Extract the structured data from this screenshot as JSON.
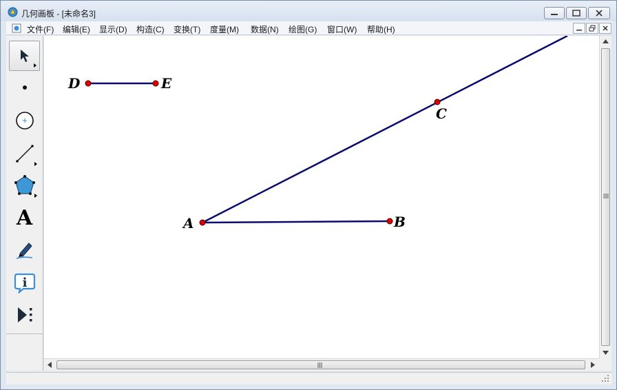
{
  "window": {
    "title": "几何画板 - [未命名3]"
  },
  "menu": {
    "items": [
      {
        "label": "文件(F)",
        "name": "menu-file"
      },
      {
        "label": "编辑(E)",
        "name": "menu-edit"
      },
      {
        "label": "显示(D)",
        "name": "menu-display"
      },
      {
        "label": "构造(C)",
        "name": "menu-construct"
      },
      {
        "label": "变换(T)",
        "name": "menu-transform"
      },
      {
        "label": "度量(M)",
        "name": "menu-measure"
      },
      {
        "label": "数据(N)",
        "name": "menu-data"
      },
      {
        "label": "绘图(G)",
        "name": "menu-graph"
      },
      {
        "label": "窗口(W)",
        "name": "menu-window"
      },
      {
        "label": "帮助(H)",
        "name": "menu-help"
      }
    ]
  },
  "toolbox": {
    "tools": [
      {
        "name": "arrow-tool",
        "icon": "arrow-icon",
        "selected": true
      },
      {
        "name": "point-tool",
        "icon": "point-icon"
      },
      {
        "name": "compass-tool",
        "icon": "compass-icon"
      },
      {
        "name": "straightedge-tool",
        "icon": "straightedge-icon"
      },
      {
        "name": "polygon-tool",
        "icon": "polygon-icon"
      },
      {
        "name": "text-tool",
        "icon": "text-icon",
        "letter": "A"
      },
      {
        "name": "marker-tool",
        "icon": "marker-icon"
      },
      {
        "name": "information-tool",
        "icon": "information-icon"
      },
      {
        "name": "custom-tool",
        "icon": "custom-tools-icon"
      }
    ]
  },
  "sketch": {
    "point_color": "#e00000",
    "segment_color": "#0a0a6e",
    "labels": {
      "A": "A",
      "B": "B",
      "C": "C",
      "D": "D",
      "E": "E"
    }
  }
}
